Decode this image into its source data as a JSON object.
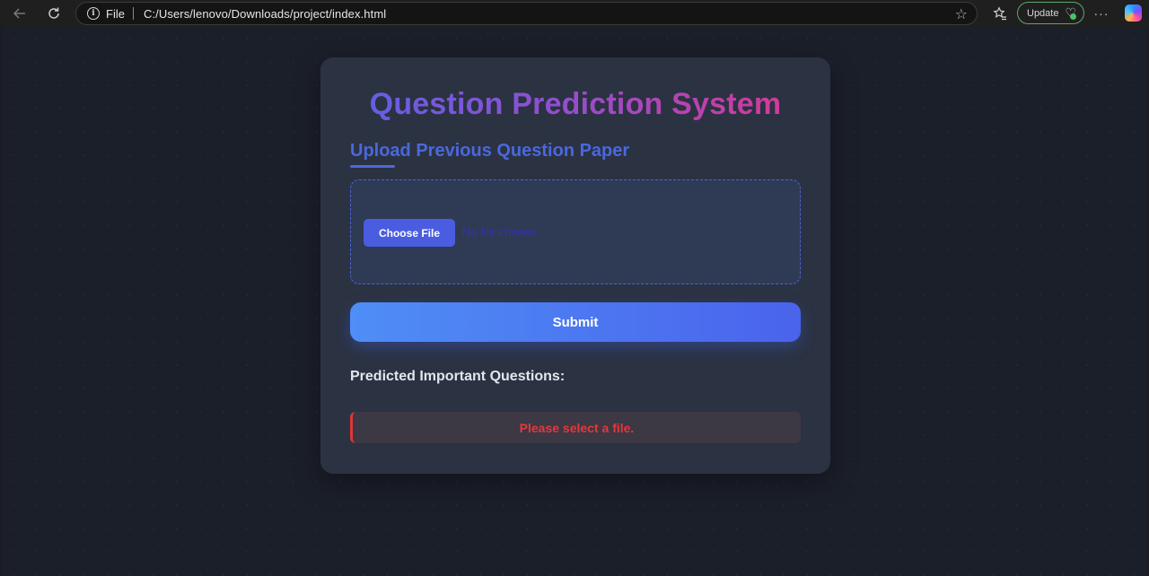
{
  "browser": {
    "scheme_label": "File",
    "url": "C:/Users/lenovo/Downloads/project/index.html",
    "update_label": "Update",
    "icons": {
      "back": "back-arrow-icon",
      "reload": "reload-icon",
      "info": "info-icon",
      "favorite": "star-icon",
      "favorites": "favorites-icon",
      "more": "more-icon",
      "copilot": "copilot-icon"
    }
  },
  "page": {
    "title": "Question Prediction System",
    "upload_heading": "Upload Previous Question Paper",
    "choose_file_label": "Choose File",
    "no_file_text": "No file chosen",
    "submit_label": "Submit",
    "results_heading": "Predicted Important Questions:",
    "error_message": "Please select a file.",
    "colors": {
      "accent": "#4a68dc",
      "title_gradient_start": "#5a63e6",
      "title_gradient_end": "#e0368f",
      "error": "#e0393d"
    }
  }
}
